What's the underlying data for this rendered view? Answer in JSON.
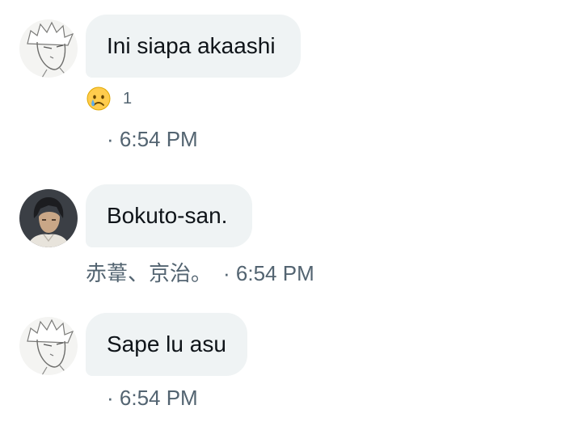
{
  "messages": [
    {
      "text": "Ini siapa akaashi",
      "reaction": {
        "icon": "crying-face-emoji",
        "count": "1"
      },
      "meta": "· 6:54 PM"
    },
    {
      "text": "Bokuto-san.",
      "sender": "赤葦、京治。",
      "meta": "· 6:54 PM"
    },
    {
      "text": "Sape lu asu",
      "meta": "· 6:54 PM"
    }
  ]
}
